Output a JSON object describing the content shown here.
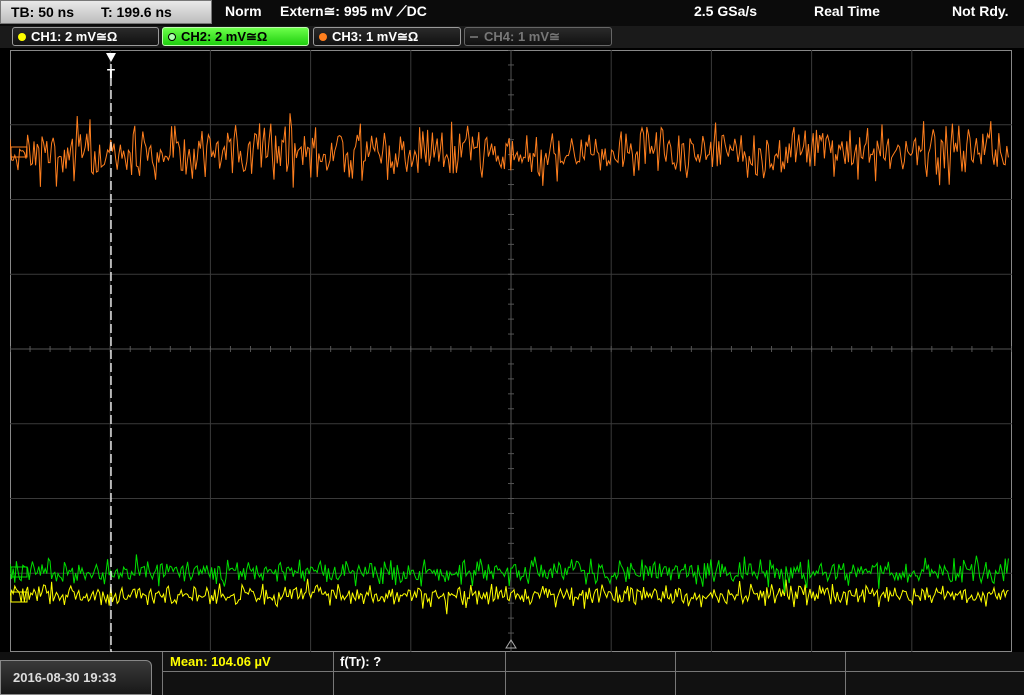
{
  "header": {
    "timebase": "TB: 50 ns",
    "trigger_time": "T: 199.6 ns",
    "trigger_mode": "Norm",
    "trigger_source": "Extern≅: 995 mV ⟋DC",
    "sample_rate": "2.5 GSa/s",
    "acq_mode": "Real Time",
    "status": "Not Rdy."
  },
  "channels": [
    {
      "label": "CH1: 2 mV≅Ω",
      "color": "#ffff00",
      "active": true
    },
    {
      "label": "CH2: 2 mV≅Ω",
      "color": "#00e000",
      "active": true,
      "selected": true
    },
    {
      "label": "CH3: 1 mV≅Ω",
      "color": "#ff7f1e",
      "active": true
    },
    {
      "label": "CH4: 1 mV≅",
      "color": "#777777",
      "active": false
    }
  ],
  "trigger_marker": "T",
  "footer": {
    "datetime": "2016-08-30 19:33",
    "measurements": [
      {
        "label": "Mean: 104.06 µV",
        "color": "#ffff00"
      },
      {
        "label": "f(Tr): ?",
        "color": "#ffffff"
      }
    ]
  },
  "colors": {
    "ch1": "#ffff00",
    "ch2": "#00e000",
    "ch3": "#ff7f1e",
    "grid": "#3a3a3a"
  }
}
